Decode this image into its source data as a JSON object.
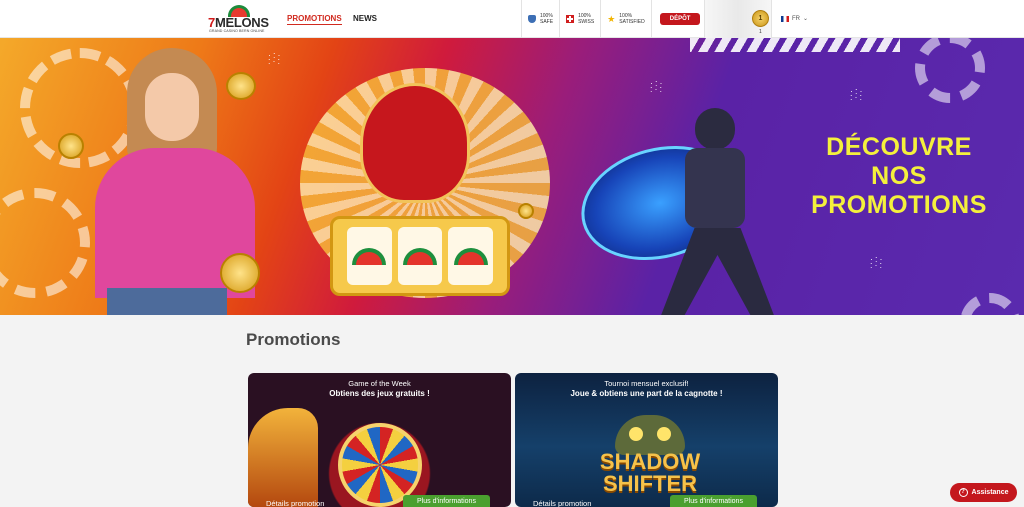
{
  "header": {
    "logo_brand_number": "7",
    "logo_brand_name": "MELONS",
    "logo_tagline": "GRAND CASINO BERN ONLINE",
    "nav": {
      "promotions": "PROMOTIONS",
      "news": "NEWS"
    },
    "badges": [
      {
        "icon": "shield-icon",
        "line1": "100%",
        "line2": "SAFE"
      },
      {
        "icon": "swiss-cross-icon",
        "line1": "100%",
        "line2": "SWISS"
      },
      {
        "icon": "star-icon",
        "line1": "100%",
        "line2": "SATISFIED"
      }
    ],
    "deposit_label": "DÉPÔT",
    "level_badge": "1",
    "level_number": "1",
    "language": "FR"
  },
  "hero": {
    "text_line1": "DÉCOUVRE",
    "text_line2": "NOS",
    "text_line3": "PROMOTIONS"
  },
  "main": {
    "title": "Promotions",
    "cards": [
      {
        "subtitle": "Game of the Week",
        "headline": "Obtiens des jeux gratuits !",
        "details": "Détails promotion",
        "more": "Plus d'informations"
      },
      {
        "subtitle": "Tournoi mensuel exclusif!",
        "headline": "Joue & obtiens une part de la cagnotte !",
        "art_title_line1": "SHADOW",
        "art_title_line2": "SHIFTER",
        "details": "Détails promotion",
        "more": "Plus d'informations"
      }
    ]
  },
  "assistance_label": "Assistance",
  "colors": {
    "brand_red": "#c4171d",
    "hero_text_yellow": "#f4f03c",
    "cta_green": "#4aa02f"
  }
}
